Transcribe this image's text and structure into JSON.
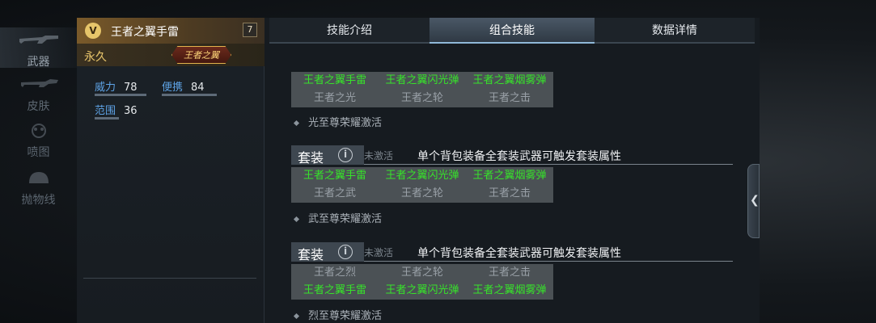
{
  "side_nav": [
    {
      "label": "武器",
      "icon": "rifle-icon",
      "active": true
    },
    {
      "label": "皮肤",
      "icon": "gun-skin-icon",
      "active": false
    },
    {
      "label": "喷图",
      "icon": "spray-icon",
      "active": false
    },
    {
      "label": "抛物线",
      "icon": "helmet-icon",
      "active": false
    }
  ],
  "weapon": {
    "name": "王者之翼手雷",
    "level_badge": "7",
    "duration": "永久",
    "title_badge": "王者之翼",
    "stats": [
      {
        "name": "威力",
        "value": "78"
      },
      {
        "name": "便携",
        "value": "84"
      },
      {
        "name": "范围",
        "value": "36"
      }
    ]
  },
  "tabs": [
    "技能介绍",
    "组合技能",
    "数据详情"
  ],
  "active_tab": "组合技能",
  "combos": [
    {
      "row1": [
        "王者之翼手雷",
        "王者之翼闪光弹",
        "王者之翼烟雾弹"
      ],
      "row2": [
        "王者之光",
        "王者之轮",
        "王者之击"
      ],
      "activation": "光至尊荣耀激活"
    },
    {
      "set_label": "套装",
      "set_status": "未激活",
      "set_desc": "单个背包装备全套装武器可触发套装属性",
      "row1": [
        "王者之翼手雷",
        "王者之翼闪光弹",
        "王者之翼烟雾弹"
      ],
      "row2": [
        "王者之武",
        "王者之轮",
        "王者之击"
      ],
      "activation": "武至尊荣耀激活"
    },
    {
      "set_label": "套装",
      "set_status": "未激活",
      "set_desc": "单个背包装备全套装武器可触发套装属性",
      "row1": [
        "王者之烈",
        "王者之轮",
        "王者之击"
      ],
      "row2": [
        "王者之翼手雷",
        "王者之翼闪光弹",
        "王者之翼烟雾弹"
      ],
      "activation": "烈至尊荣耀激活"
    }
  ],
  "colors": {
    "accent_green": "#37e32a",
    "stat_blue": "#5ea3e6",
    "gold": "#e9c66c"
  }
}
